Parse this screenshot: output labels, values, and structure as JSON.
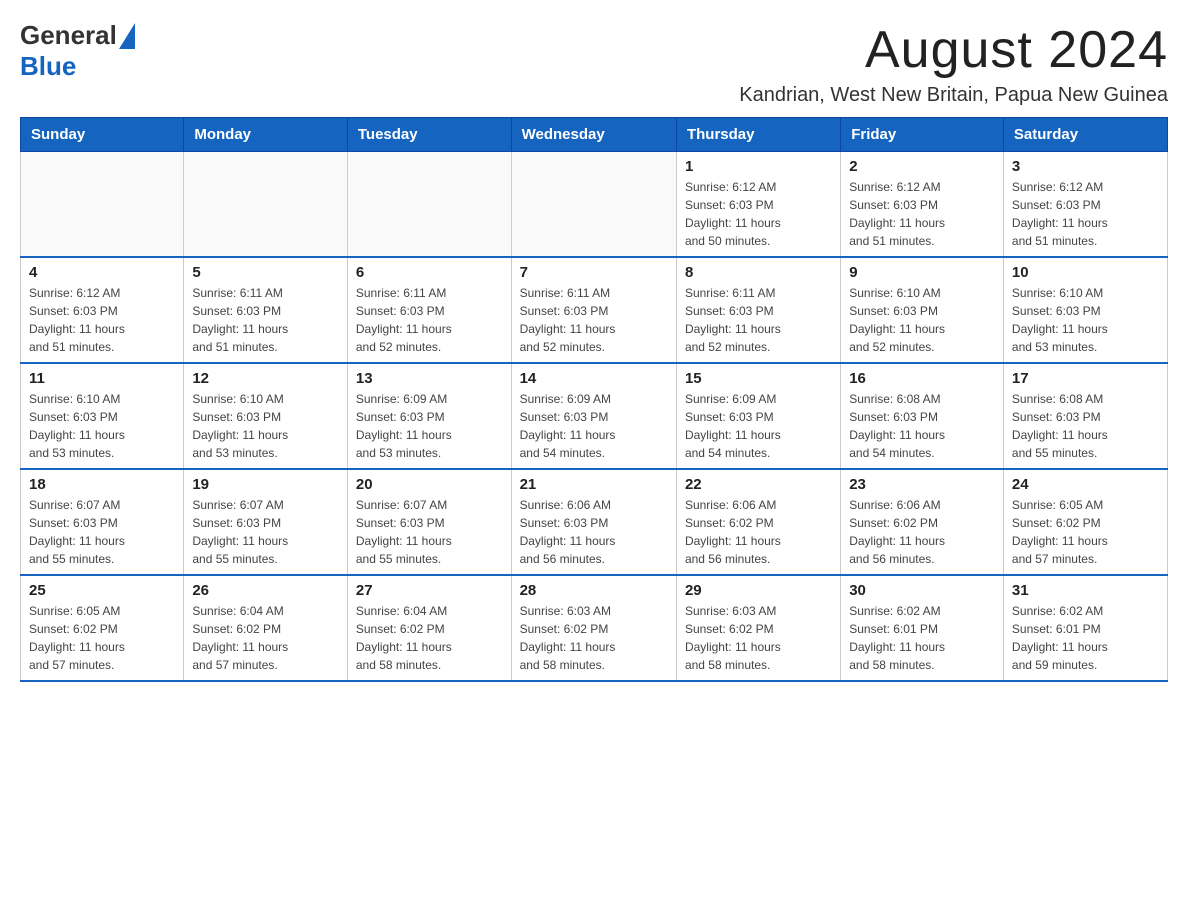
{
  "header": {
    "logo_general": "General",
    "logo_blue": "Blue",
    "main_title": "August 2024",
    "subtitle": "Kandrian, West New Britain, Papua New Guinea"
  },
  "calendar": {
    "days_of_week": [
      "Sunday",
      "Monday",
      "Tuesday",
      "Wednesday",
      "Thursday",
      "Friday",
      "Saturday"
    ],
    "weeks": [
      [
        {
          "day": "",
          "info": ""
        },
        {
          "day": "",
          "info": ""
        },
        {
          "day": "",
          "info": ""
        },
        {
          "day": "",
          "info": ""
        },
        {
          "day": "1",
          "info": "Sunrise: 6:12 AM\nSunset: 6:03 PM\nDaylight: 11 hours\nand 50 minutes."
        },
        {
          "day": "2",
          "info": "Sunrise: 6:12 AM\nSunset: 6:03 PM\nDaylight: 11 hours\nand 51 minutes."
        },
        {
          "day": "3",
          "info": "Sunrise: 6:12 AM\nSunset: 6:03 PM\nDaylight: 11 hours\nand 51 minutes."
        }
      ],
      [
        {
          "day": "4",
          "info": "Sunrise: 6:12 AM\nSunset: 6:03 PM\nDaylight: 11 hours\nand 51 minutes."
        },
        {
          "day": "5",
          "info": "Sunrise: 6:11 AM\nSunset: 6:03 PM\nDaylight: 11 hours\nand 51 minutes."
        },
        {
          "day": "6",
          "info": "Sunrise: 6:11 AM\nSunset: 6:03 PM\nDaylight: 11 hours\nand 52 minutes."
        },
        {
          "day": "7",
          "info": "Sunrise: 6:11 AM\nSunset: 6:03 PM\nDaylight: 11 hours\nand 52 minutes."
        },
        {
          "day": "8",
          "info": "Sunrise: 6:11 AM\nSunset: 6:03 PM\nDaylight: 11 hours\nand 52 minutes."
        },
        {
          "day": "9",
          "info": "Sunrise: 6:10 AM\nSunset: 6:03 PM\nDaylight: 11 hours\nand 52 minutes."
        },
        {
          "day": "10",
          "info": "Sunrise: 6:10 AM\nSunset: 6:03 PM\nDaylight: 11 hours\nand 53 minutes."
        }
      ],
      [
        {
          "day": "11",
          "info": "Sunrise: 6:10 AM\nSunset: 6:03 PM\nDaylight: 11 hours\nand 53 minutes."
        },
        {
          "day": "12",
          "info": "Sunrise: 6:10 AM\nSunset: 6:03 PM\nDaylight: 11 hours\nand 53 minutes."
        },
        {
          "day": "13",
          "info": "Sunrise: 6:09 AM\nSunset: 6:03 PM\nDaylight: 11 hours\nand 53 minutes."
        },
        {
          "day": "14",
          "info": "Sunrise: 6:09 AM\nSunset: 6:03 PM\nDaylight: 11 hours\nand 54 minutes."
        },
        {
          "day": "15",
          "info": "Sunrise: 6:09 AM\nSunset: 6:03 PM\nDaylight: 11 hours\nand 54 minutes."
        },
        {
          "day": "16",
          "info": "Sunrise: 6:08 AM\nSunset: 6:03 PM\nDaylight: 11 hours\nand 54 minutes."
        },
        {
          "day": "17",
          "info": "Sunrise: 6:08 AM\nSunset: 6:03 PM\nDaylight: 11 hours\nand 55 minutes."
        }
      ],
      [
        {
          "day": "18",
          "info": "Sunrise: 6:07 AM\nSunset: 6:03 PM\nDaylight: 11 hours\nand 55 minutes."
        },
        {
          "day": "19",
          "info": "Sunrise: 6:07 AM\nSunset: 6:03 PM\nDaylight: 11 hours\nand 55 minutes."
        },
        {
          "day": "20",
          "info": "Sunrise: 6:07 AM\nSunset: 6:03 PM\nDaylight: 11 hours\nand 55 minutes."
        },
        {
          "day": "21",
          "info": "Sunrise: 6:06 AM\nSunset: 6:03 PM\nDaylight: 11 hours\nand 56 minutes."
        },
        {
          "day": "22",
          "info": "Sunrise: 6:06 AM\nSunset: 6:02 PM\nDaylight: 11 hours\nand 56 minutes."
        },
        {
          "day": "23",
          "info": "Sunrise: 6:06 AM\nSunset: 6:02 PM\nDaylight: 11 hours\nand 56 minutes."
        },
        {
          "day": "24",
          "info": "Sunrise: 6:05 AM\nSunset: 6:02 PM\nDaylight: 11 hours\nand 57 minutes."
        }
      ],
      [
        {
          "day": "25",
          "info": "Sunrise: 6:05 AM\nSunset: 6:02 PM\nDaylight: 11 hours\nand 57 minutes."
        },
        {
          "day": "26",
          "info": "Sunrise: 6:04 AM\nSunset: 6:02 PM\nDaylight: 11 hours\nand 57 minutes."
        },
        {
          "day": "27",
          "info": "Sunrise: 6:04 AM\nSunset: 6:02 PM\nDaylight: 11 hours\nand 58 minutes."
        },
        {
          "day": "28",
          "info": "Sunrise: 6:03 AM\nSunset: 6:02 PM\nDaylight: 11 hours\nand 58 minutes."
        },
        {
          "day": "29",
          "info": "Sunrise: 6:03 AM\nSunset: 6:02 PM\nDaylight: 11 hours\nand 58 minutes."
        },
        {
          "day": "30",
          "info": "Sunrise: 6:02 AM\nSunset: 6:01 PM\nDaylight: 11 hours\nand 58 minutes."
        },
        {
          "day": "31",
          "info": "Sunrise: 6:02 AM\nSunset: 6:01 PM\nDaylight: 11 hours\nand 59 minutes."
        }
      ]
    ]
  }
}
